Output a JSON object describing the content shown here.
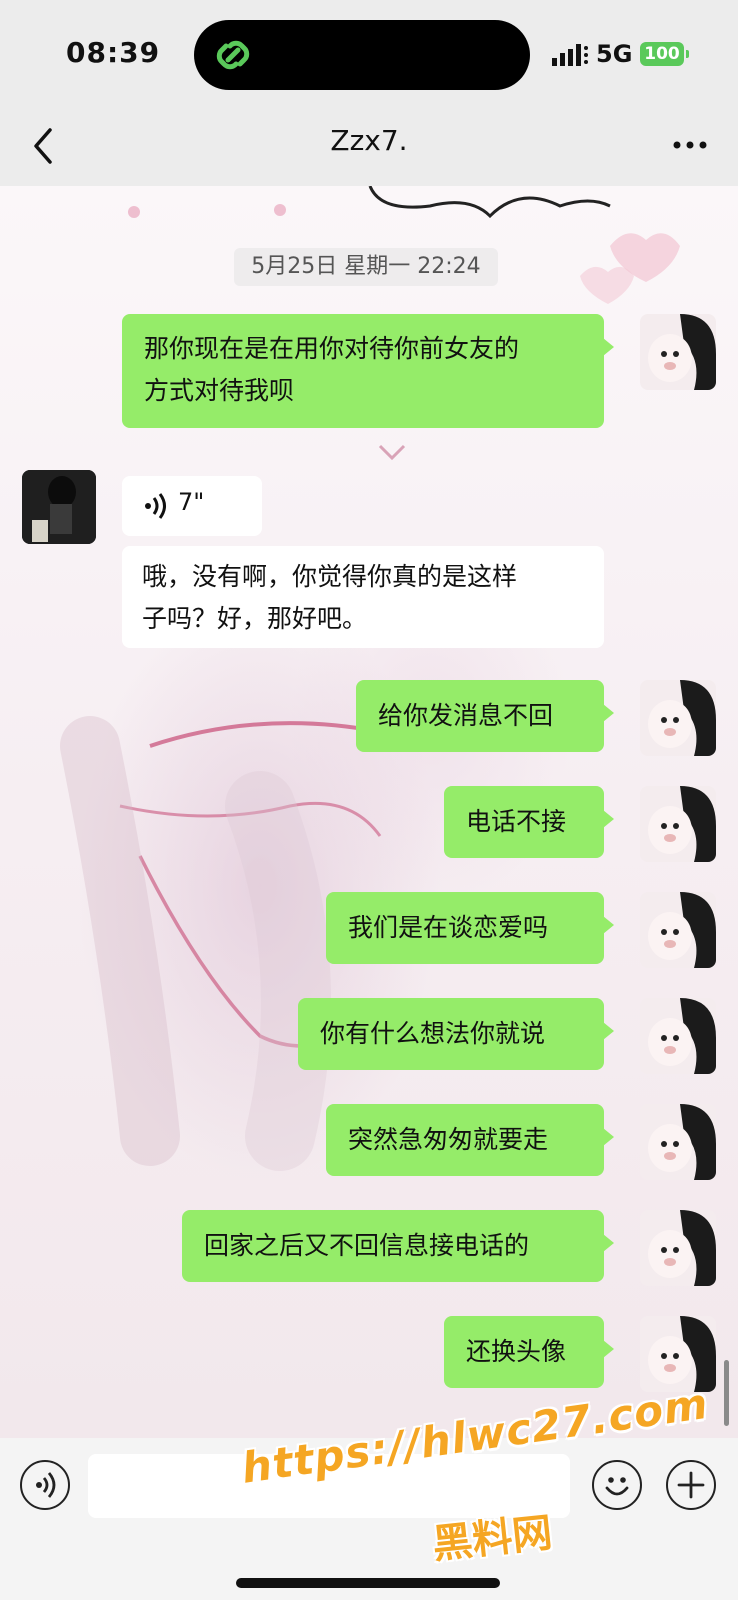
{
  "status_bar": {
    "time": "08:39",
    "network": "5G",
    "battery": "100"
  },
  "nav": {
    "title": "Zzx7.",
    "back_icon": "chevron-left-icon",
    "more_icon": "more-icon"
  },
  "chat": {
    "timestamp": "5月25日 星期一 22:24",
    "messages": [
      {
        "sender": "me",
        "lines": [
          "那你现在是在用你对待你前女友的",
          "方式对待我呗"
        ]
      },
      {
        "sender": "other",
        "type": "voice",
        "duration": "7\""
      },
      {
        "sender": "other",
        "lines": [
          "哦，没有啊，你觉得你真的是这样",
          "子吗？好，那好吧。"
        ]
      },
      {
        "sender": "me",
        "text": "给你发消息不回"
      },
      {
        "sender": "me",
        "text": "电话不接"
      },
      {
        "sender": "me",
        "text": "我们是在谈恋爱吗"
      },
      {
        "sender": "me",
        "text": "你有什么想法你就说"
      },
      {
        "sender": "me",
        "text": "突然急匆匆就要走"
      },
      {
        "sender": "me",
        "text": "回家之后又不回信息接电话的"
      },
      {
        "sender": "me",
        "text": "还换头像"
      }
    ]
  },
  "input_bar": {
    "voice_icon": "voice-icon",
    "emoji_icon": "emoji-icon",
    "plus_icon": "plus-icon"
  },
  "watermark": {
    "url": "https://hlwc27.com",
    "name": "黑料网"
  },
  "colors": {
    "my_bubble": "#95ec69",
    "their_bubble": "#ffffff",
    "battery": "#5ac95a",
    "watermark": "#f5a623"
  }
}
